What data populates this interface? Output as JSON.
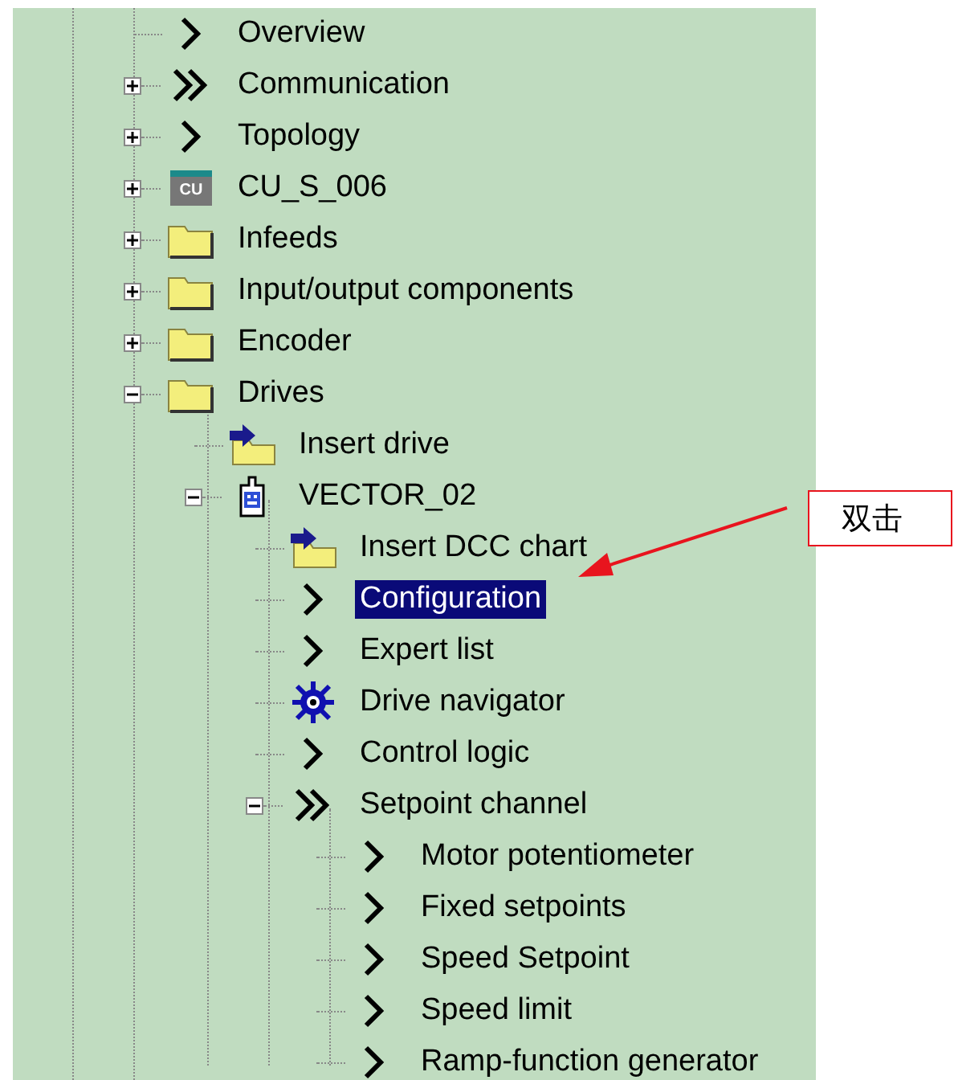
{
  "tree": {
    "items": [
      {
        "label": "Overview",
        "kind": "chevron",
        "selected": false
      },
      {
        "label": "Communication",
        "kind": "double-chevron",
        "expanded": false,
        "selected": false
      },
      {
        "label": "Topology",
        "kind": "chevron",
        "expanded": false,
        "selected": false
      },
      {
        "label": "CU_S_006",
        "kind": "cu",
        "icon_text": "CU",
        "expanded": false,
        "selected": false
      },
      {
        "label": "Infeeds",
        "kind": "folder",
        "expanded": false,
        "selected": false
      },
      {
        "label": "Input/output components",
        "kind": "folder",
        "expanded": false,
        "selected": false
      },
      {
        "label": "Encoder",
        "kind": "folder",
        "expanded": false,
        "selected": false
      },
      {
        "label": "Drives",
        "kind": "folder",
        "expanded": true,
        "selected": false,
        "children": [
          {
            "label": "Insert drive",
            "kind": "insert",
            "selected": false
          },
          {
            "label": "VECTOR_02",
            "kind": "device",
            "expanded": true,
            "selected": false,
            "children": [
              {
                "label": "Insert DCC chart",
                "kind": "insert",
                "selected": false
              },
              {
                "label": "Configuration",
                "kind": "chevron",
                "selected": true
              },
              {
                "label": "Expert list",
                "kind": "chevron",
                "selected": false
              },
              {
                "label": "Drive navigator",
                "kind": "navigator",
                "selected": false
              },
              {
                "label": "Control logic",
                "kind": "chevron",
                "selected": false
              },
              {
                "label": "Setpoint channel",
                "kind": "double-chevron",
                "expanded": true,
                "selected": false,
                "children": [
                  {
                    "label": "Motor potentiometer",
                    "kind": "chevron",
                    "selected": false
                  },
                  {
                    "label": "Fixed setpoints",
                    "kind": "chevron",
                    "selected": false
                  },
                  {
                    "label": "Speed Setpoint",
                    "kind": "chevron",
                    "selected": false
                  },
                  {
                    "label": "Speed limit",
                    "kind": "chevron",
                    "selected": false
                  },
                  {
                    "label": "Ramp-function generator",
                    "kind": "chevron",
                    "selected": false
                  }
                ]
              }
            ]
          }
        ]
      }
    ]
  },
  "callout": {
    "text": "双击"
  }
}
